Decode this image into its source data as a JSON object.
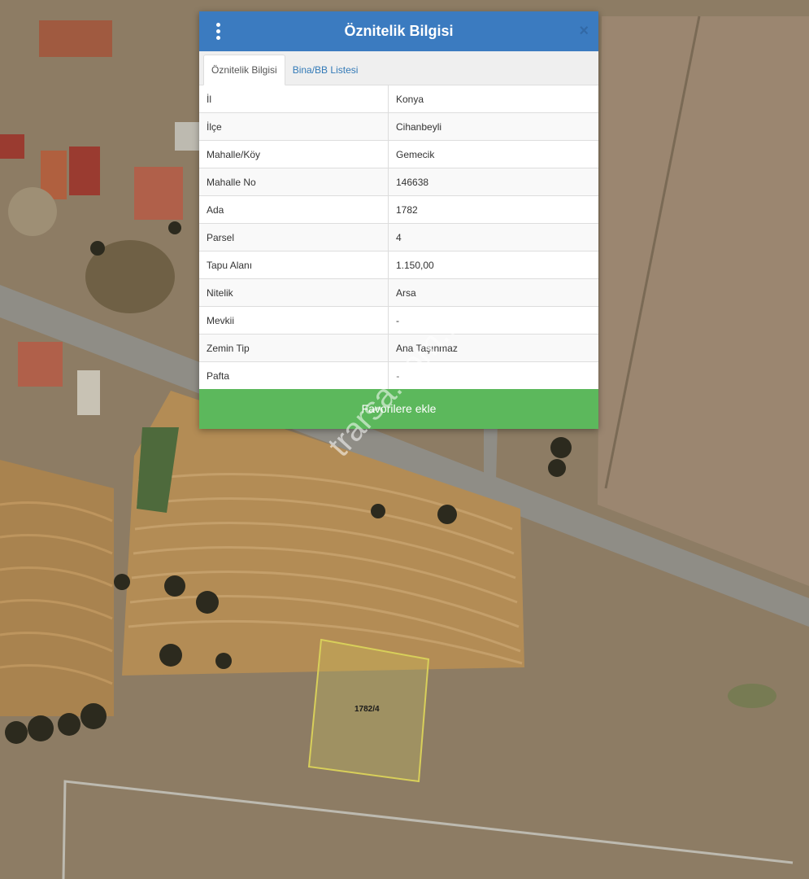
{
  "popup": {
    "title": "Öznitelik Bilgisi",
    "close_glyph": "×",
    "menu_icon": "vertical-dots-icon",
    "tabs": [
      {
        "label": "Öznitelik Bilgisi",
        "active": true
      },
      {
        "label": "Bina/BB Listesi",
        "active": false
      }
    ],
    "rows": [
      {
        "key": "İl",
        "value": "Konya"
      },
      {
        "key": "İlçe",
        "value": "Cihanbeyli"
      },
      {
        "key": "Mahalle/Köy",
        "value": "Gemecik"
      },
      {
        "key": "Mahalle No",
        "value": "146638"
      },
      {
        "key": "Ada",
        "value": "1782"
      },
      {
        "key": "Parsel",
        "value": "4"
      },
      {
        "key": "Tapu Alanı",
        "value": "1.150,00"
      },
      {
        "key": "Nitelik",
        "value": "Arsa"
      },
      {
        "key": "Mevkii",
        "value": "-"
      },
      {
        "key": "Zemin Tip",
        "value": "Ana Taşınmaz"
      },
      {
        "key": "Pafta",
        "value": "-"
      }
    ],
    "favorite_label": "Favorilere ekle"
  },
  "map": {
    "parcel_label": "1782/4",
    "watermark": "trarsa.com.tr"
  },
  "colors": {
    "header": "#3b7bc0",
    "favorite": "#5cb85c",
    "parcel_outline": "#d8cf5a"
  }
}
